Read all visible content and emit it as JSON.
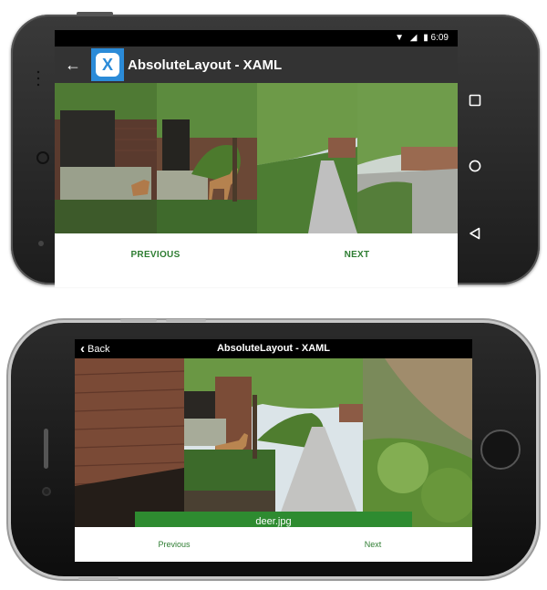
{
  "android": {
    "status_time": "6:09",
    "toolbar_title": "AbsoluteLayout - XAML",
    "logo_letter": "X",
    "previous_label": "PREVIOUS",
    "next_label": "NEXT",
    "nav_buttons": [
      "recents-icon",
      "home-icon",
      "back-icon"
    ],
    "accent_color": "#2e7d32",
    "toolbar_color": "#333333",
    "logo_color": "#2b8bd8"
  },
  "ios": {
    "back_label": "Back",
    "title": "AbsoluteLayout - XAML",
    "caption": "deer.jpg",
    "previous_label": "Previous",
    "next_label": "Next",
    "caption_color": "#2e8b30"
  }
}
